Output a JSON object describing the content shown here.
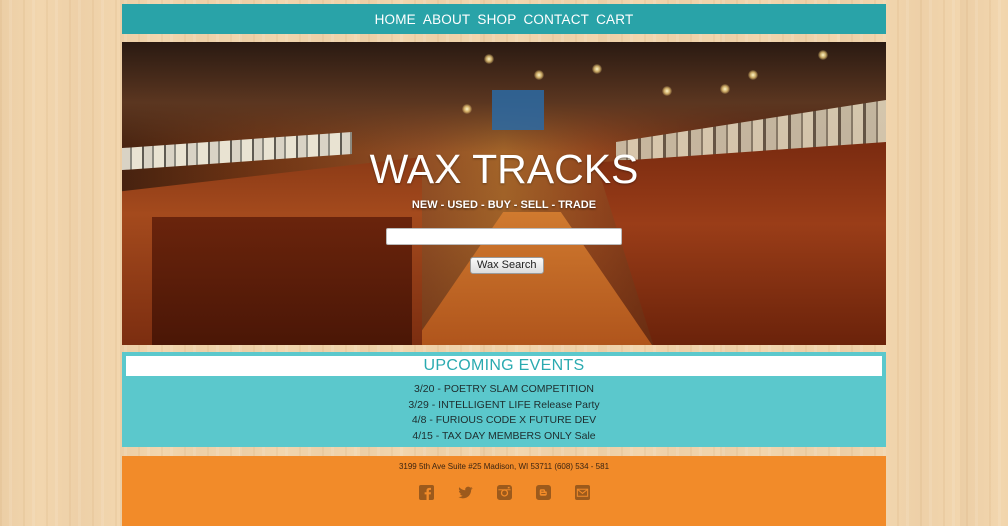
{
  "nav": {
    "items": [
      {
        "label": "HOME"
      },
      {
        "label": "ABOUT"
      },
      {
        "label": "SHOP"
      },
      {
        "label": "CONTACT"
      },
      {
        "label": "CART"
      }
    ]
  },
  "hero": {
    "title": "WAX TRACKS",
    "tagline": "NEW - USED - BUY - SELL - TRADE",
    "search": {
      "value": "",
      "placeholder": ""
    },
    "search_button_label": "Wax Search"
  },
  "events": {
    "heading": "UPCOMING EVENTS",
    "items": [
      {
        "text": "3/20 - POETRY SLAM COMPETITION"
      },
      {
        "text": "3/29 - INTELLIGENT LIFE Release Party"
      },
      {
        "text": "4/8 - FURIOUS CODE X FUTURE DEV"
      },
      {
        "text": "4/15 - TAX DAY MEMBERS ONLY Sale"
      }
    ]
  },
  "footer": {
    "address": "3199 5th Ave Suite #25 Madison, WI 53711 (608) 534 - 581",
    "social_icons": [
      "facebook-icon",
      "twitter-icon",
      "instagram-icon",
      "blogger-icon",
      "mail-icon"
    ]
  },
  "colors": {
    "nav_bg": "#29a3a8",
    "events_bg": "#5bc8cc",
    "events_heading": "#2aaab0",
    "footer_bg": "#f28b29",
    "icon_color": "#9c5a1c"
  }
}
